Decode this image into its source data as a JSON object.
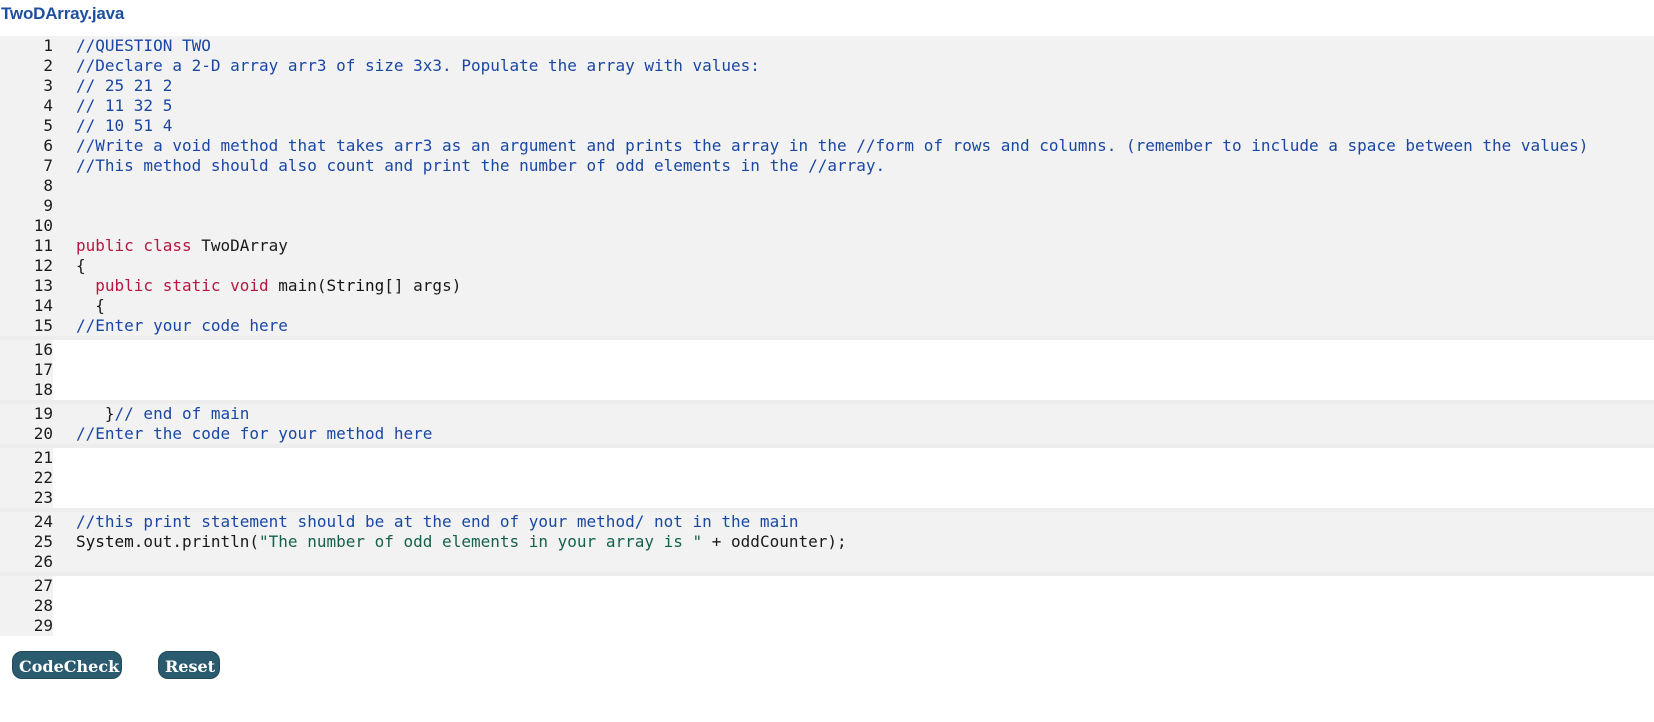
{
  "file": {
    "title": "TwoDArray.java"
  },
  "colors": {
    "title": "#1f4fa0",
    "comment": "#1a47a3",
    "keyword": "#b5173f",
    "string": "#16604b",
    "readonly_bg": "#f2f2f2",
    "editable_bg": "#ffffff",
    "button_bg": "#2a5b6f"
  },
  "editor": {
    "lines": [
      {
        "n": "1",
        "kind": "ro",
        "segs": [
          {
            "t": "comment",
            "s": "//QUESTION TWO"
          }
        ]
      },
      {
        "n": "2",
        "kind": "ro",
        "segs": [
          {
            "t": "comment",
            "s": "//Declare a 2-D array arr3 of size 3x3. Populate the array with values:"
          }
        ]
      },
      {
        "n": "3",
        "kind": "ro",
        "segs": [
          {
            "t": "comment",
            "s": "// 25 21 2"
          }
        ]
      },
      {
        "n": "4",
        "kind": "ro",
        "segs": [
          {
            "t": "comment",
            "s": "// 11 32 5"
          }
        ]
      },
      {
        "n": "5",
        "kind": "ro",
        "segs": [
          {
            "t": "comment",
            "s": "// 10 51 4"
          }
        ]
      },
      {
        "n": "6",
        "kind": "ro",
        "segs": [
          {
            "t": "comment",
            "s": "//Write a void method that takes arr3 as an argument and prints the array in the //form of rows and columns. (remember to include a space between the values)"
          }
        ]
      },
      {
        "n": "7",
        "kind": "ro",
        "segs": [
          {
            "t": "comment",
            "s": "//This method should also count and print the number of odd elements in the //array."
          }
        ]
      },
      {
        "n": "8",
        "kind": "ro",
        "segs": []
      },
      {
        "n": "9",
        "kind": "ro",
        "segs": []
      },
      {
        "n": "10",
        "kind": "ro",
        "segs": []
      },
      {
        "n": "11",
        "kind": "ro",
        "segs": [
          {
            "t": "keyword",
            "s": "public class "
          },
          {
            "t": "plain",
            "s": "TwoDArray"
          }
        ]
      },
      {
        "n": "12",
        "kind": "ro",
        "segs": [
          {
            "t": "plain",
            "s": "{"
          }
        ]
      },
      {
        "n": "13",
        "kind": "ro",
        "segs": [
          {
            "t": "plain",
            "s": "  "
          },
          {
            "t": "keyword",
            "s": "public static void "
          },
          {
            "t": "plain",
            "s": "main("
          },
          {
            "t": "type",
            "s": "String"
          },
          {
            "t": "plain",
            "s": "[] args)"
          }
        ]
      },
      {
        "n": "14",
        "kind": "ro",
        "segs": [
          {
            "t": "plain",
            "s": "  {"
          }
        ]
      },
      {
        "n": "15",
        "kind": "ro",
        "segs": [
          {
            "t": "comment",
            "s": "//Enter your code here"
          }
        ]
      },
      {
        "n": "16",
        "kind": "ed",
        "segs": []
      },
      {
        "n": "17",
        "kind": "ed",
        "segs": []
      },
      {
        "n": "18",
        "kind": "ed",
        "segs": []
      },
      {
        "n": "19",
        "kind": "ro",
        "segs": [
          {
            "t": "plain",
            "s": "   }"
          },
          {
            "t": "comment",
            "s": "// end of main"
          }
        ]
      },
      {
        "n": "20",
        "kind": "ro",
        "segs": [
          {
            "t": "comment",
            "s": "//Enter the code for your method here"
          }
        ]
      },
      {
        "n": "21",
        "kind": "ed",
        "segs": []
      },
      {
        "n": "22",
        "kind": "ed",
        "segs": []
      },
      {
        "n": "23",
        "kind": "ed",
        "segs": []
      },
      {
        "n": "24",
        "kind": "ro",
        "segs": [
          {
            "t": "comment",
            "s": "//this print statement should be at the end of your method/ not in the main"
          }
        ]
      },
      {
        "n": "25",
        "kind": "ro",
        "segs": [
          {
            "t": "type",
            "s": "System"
          },
          {
            "t": "plain",
            "s": ".out.println("
          },
          {
            "t": "string",
            "s": "\"The number of odd elements in your array is \""
          },
          {
            "t": "plain",
            "s": " + oddCounter);"
          }
        ]
      },
      {
        "n": "26",
        "kind": "ro",
        "segs": []
      },
      {
        "n": "27",
        "kind": "ed",
        "segs": []
      },
      {
        "n": "28",
        "kind": "ed",
        "segs": []
      },
      {
        "n": "29",
        "kind": "ed",
        "segs": []
      }
    ]
  },
  "buttons": {
    "codecheck_label": "CodeCheck",
    "reset_label": "Reset"
  }
}
